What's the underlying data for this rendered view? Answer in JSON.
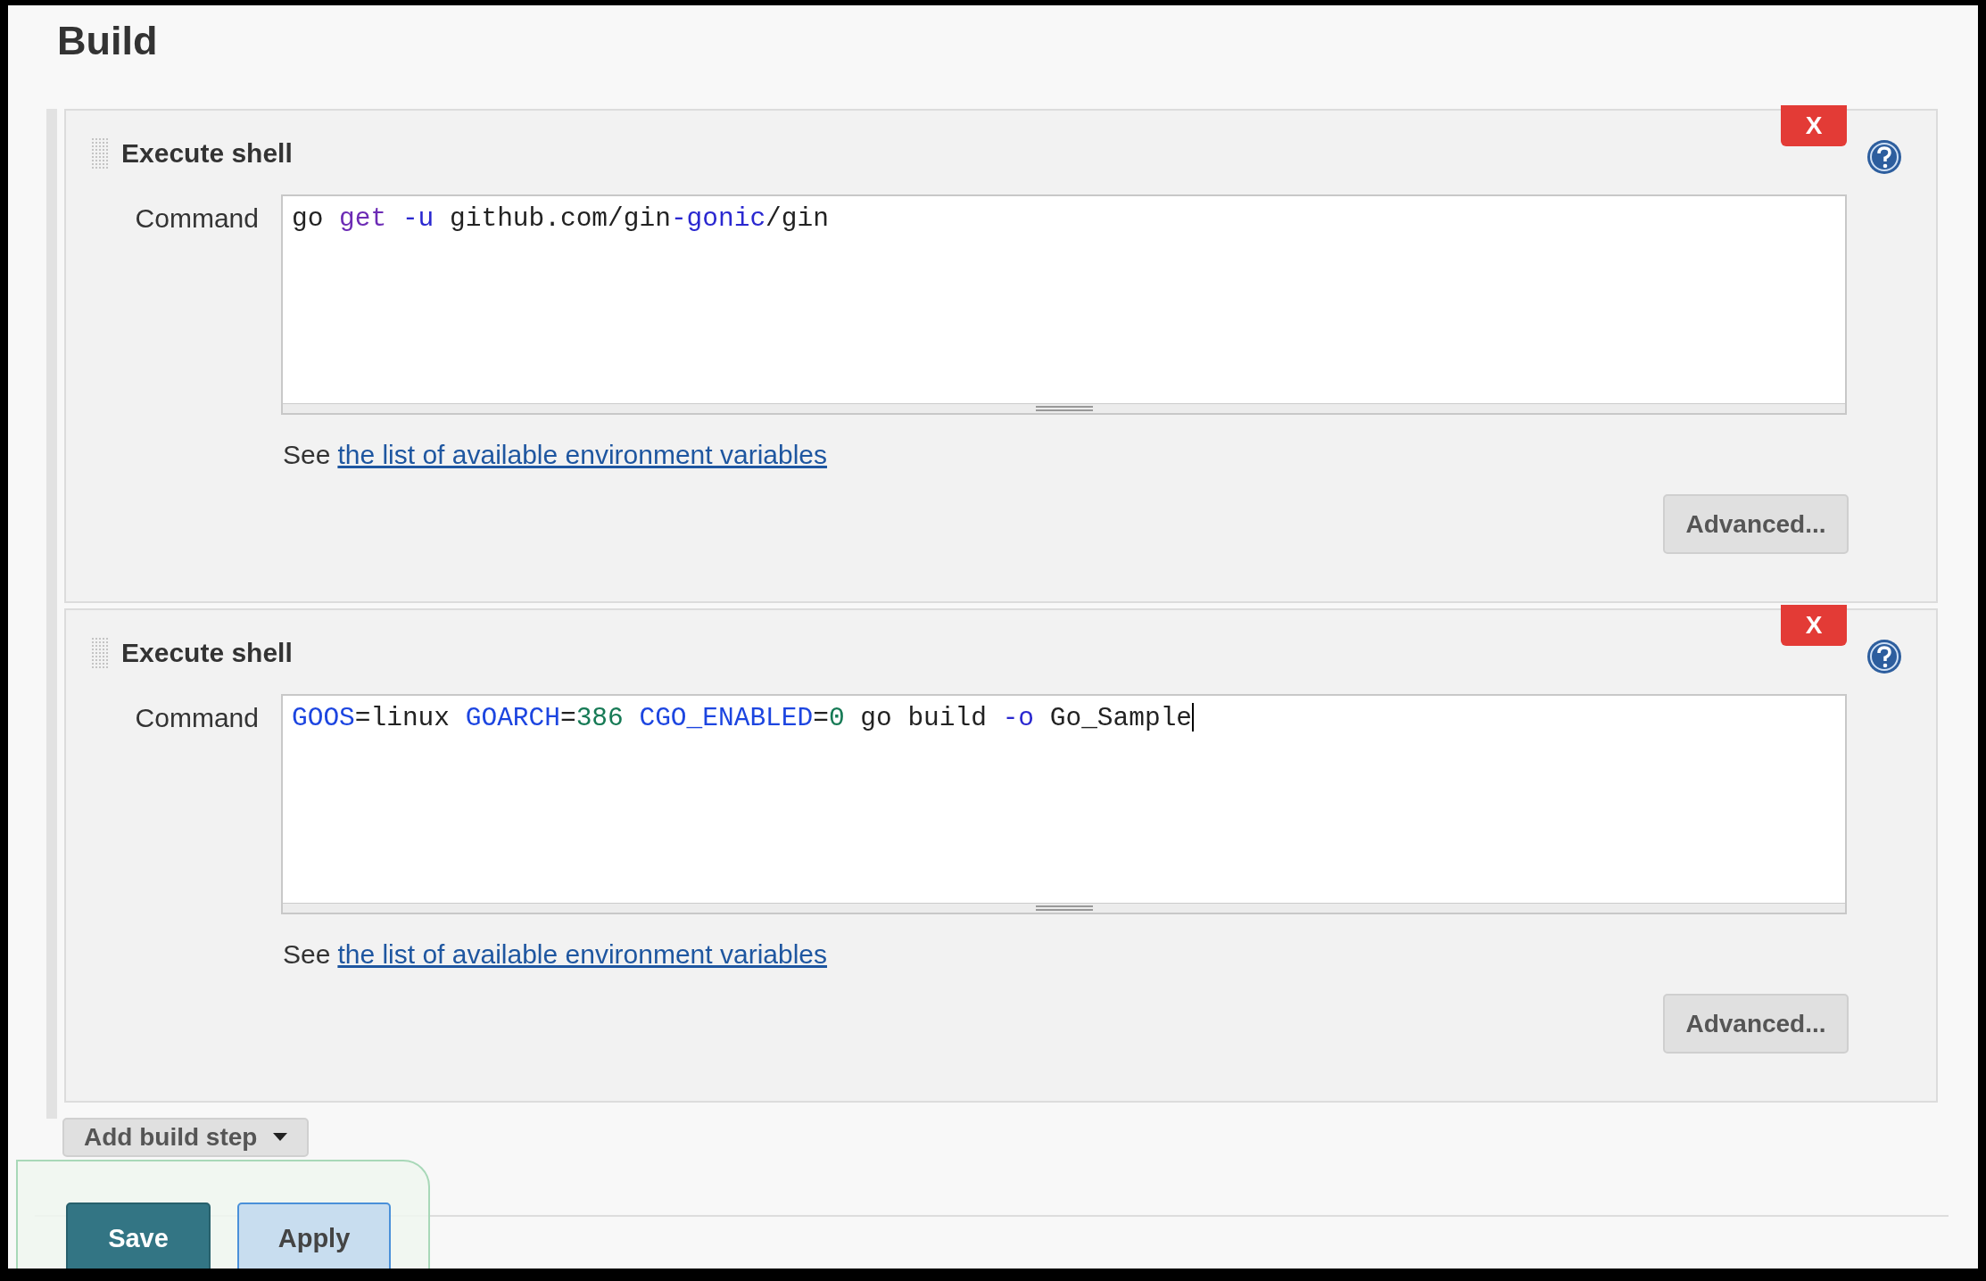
{
  "title": "Build",
  "steps": [
    {
      "title": "Execute shell",
      "delete_label": "X",
      "command_label": "Command",
      "command": [
        {
          "kind": "plain",
          "text": "go "
        },
        {
          "kind": "keyword",
          "text": "get"
        },
        {
          "kind": "flag",
          "text": " -u"
        },
        {
          "kind": "plain",
          "text": " github.com/gin"
        },
        {
          "kind": "flag",
          "text": "-gonic"
        },
        {
          "kind": "plain",
          "text": "/gin"
        }
      ],
      "caret": false,
      "hint_prefix": "See",
      "hint_link": "the list of available environment variables",
      "advanced_label": "Advanced..."
    },
    {
      "title": "Execute shell",
      "delete_label": "X",
      "command_label": "Command",
      "command": [
        {
          "kind": "variable",
          "text": "GOOS"
        },
        {
          "kind": "plain",
          "text": "=linux "
        },
        {
          "kind": "variable",
          "text": "GOARCH"
        },
        {
          "kind": "plain",
          "text": "="
        },
        {
          "kind": "number",
          "text": "386"
        },
        {
          "kind": "variable",
          "text": " CGO_ENABLED"
        },
        {
          "kind": "plain",
          "text": "="
        },
        {
          "kind": "number",
          "text": "0"
        },
        {
          "kind": "plain",
          "text": " go build "
        },
        {
          "kind": "flag",
          "text": "-o"
        },
        {
          "kind": "plain",
          "text": " Go_Sample"
        }
      ],
      "caret": true,
      "hint_prefix": "See",
      "hint_link": "the list of available environment variables",
      "advanced_label": "Advanced..."
    }
  ],
  "add_step": {
    "label": "Add build step"
  },
  "actions": [
    {
      "label": "Save",
      "kind": "primary"
    },
    {
      "label": "Apply",
      "kind": "secondary"
    }
  ]
}
